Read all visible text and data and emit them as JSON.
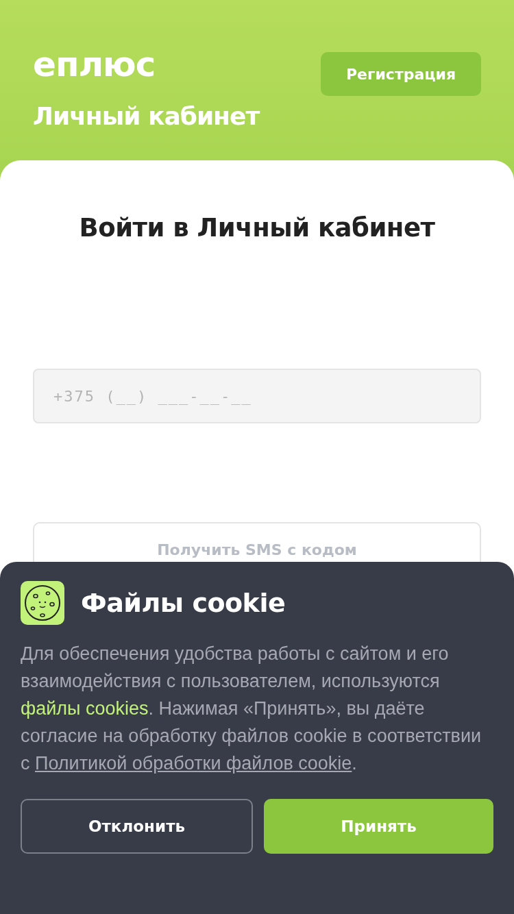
{
  "header": {
    "logo": "еплюс",
    "subtitle": "Личный кабинет",
    "register_button": "Регистрация"
  },
  "login": {
    "title": "Войти в Личный кабинет",
    "phone_field": {
      "placeholder": "+375 (__) ___-__-__"
    },
    "sms_button": {
      "label": "Получить SMS с кодом",
      "disabled": true
    }
  },
  "cookie_banner": {
    "title": "Файлы cookie",
    "text": [
      {
        "kind": "text",
        "text": "Для обеспечения удобства работы с сайтом и его взаимодействия с пользователем, используются "
      },
      {
        "kind": "highlight_link",
        "text": "файлы cookies"
      },
      {
        "kind": "text",
        "text": ". Нажимая «Принять», вы даёте согласие на обработку файлов cookie в соответствии с "
      },
      {
        "kind": "underline_link",
        "text": "Политикой обработки файлов cookie"
      },
      {
        "kind": "text",
        "text": "."
      }
    ],
    "buttons": [
      {
        "kind": "secondary",
        "label": "Отклонить"
      },
      {
        "kind": "primary",
        "label": "Принять"
      }
    ]
  }
}
